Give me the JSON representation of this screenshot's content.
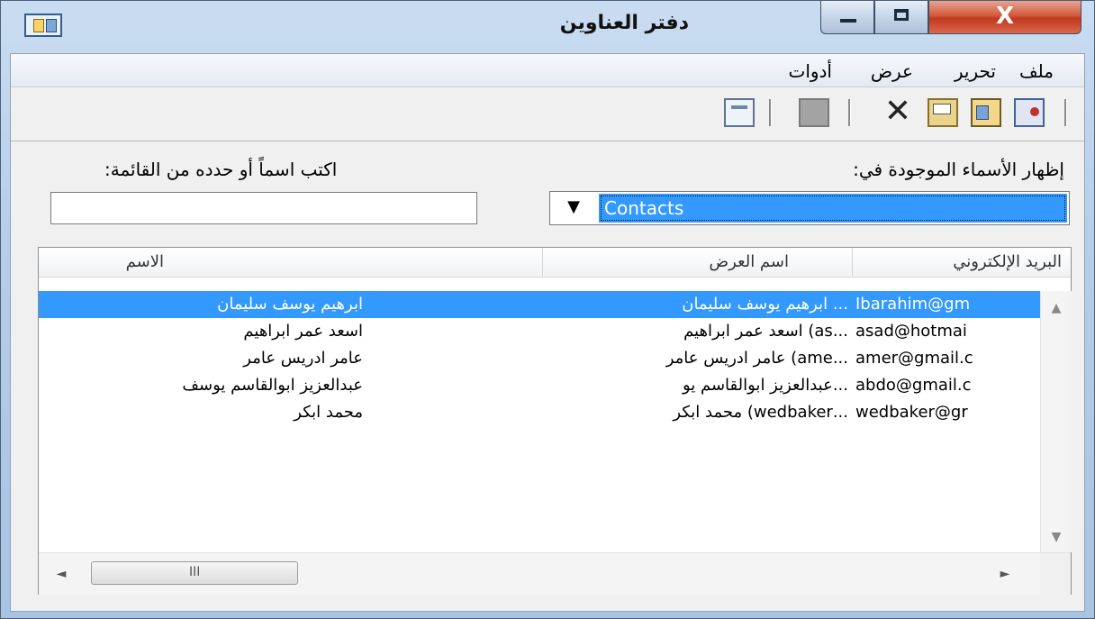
{
  "window": {
    "title": "دفتر العناوين",
    "close_glyph": "X"
  },
  "menu": {
    "file": "ملف",
    "edit": "تحرير",
    "view": "عرض",
    "tools": "أدوات"
  },
  "toolbar": {
    "icons": [
      "new-contact-icon",
      "new-group-icon",
      "properties-icon",
      "delete-icon",
      "find-people-icon",
      "print-icon"
    ],
    "delete_glyph": "✕"
  },
  "search": {
    "label": "اكتب اسماً أو حدده من القائمة:",
    "value": "",
    "placeholder": ""
  },
  "folder": {
    "label": "إظهار الأسماء الموجودة في:",
    "selected": "Contacts",
    "arrow": "▼"
  },
  "list": {
    "columns": {
      "email": "البريد الإلكتروني",
      "display_name": "اسم العرض",
      "name": "الاسم"
    },
    "rows": [
      {
        "email": "Ibarahim@gm",
        "display": "... ابرهيم يوسف سليمان",
        "name": "ابرهيم يوسف سليمان",
        "selected": true
      },
      {
        "email": "asad@hotmai",
        "display": "...as) اسعد عمر ابراهيم",
        "name": "اسعد عمر ابراهيم",
        "selected": false
      },
      {
        "email": "amer@gmail.c",
        "display": "...ame) عامر ادريس عامر",
        "name": "عامر ادريس عامر",
        "selected": false
      },
      {
        "email": "abdo@gmail.c",
        "display": "...عبدالعزيز ابوالقاسم يو",
        "name": "عبدالعزيز ابوالقاسم يوسف",
        "selected": false
      },
      {
        "email": "wedbaker@gr",
        "display": "...wedbaker) محمد ابكر",
        "name": "محمد ابكر",
        "selected": false
      }
    ]
  },
  "scroll": {
    "up": "▲",
    "down": "▼",
    "left": "◄",
    "right": "►",
    "grip": "III"
  },
  "colors": {
    "selection": "#3399ff",
    "close_button": "#c2391f"
  }
}
